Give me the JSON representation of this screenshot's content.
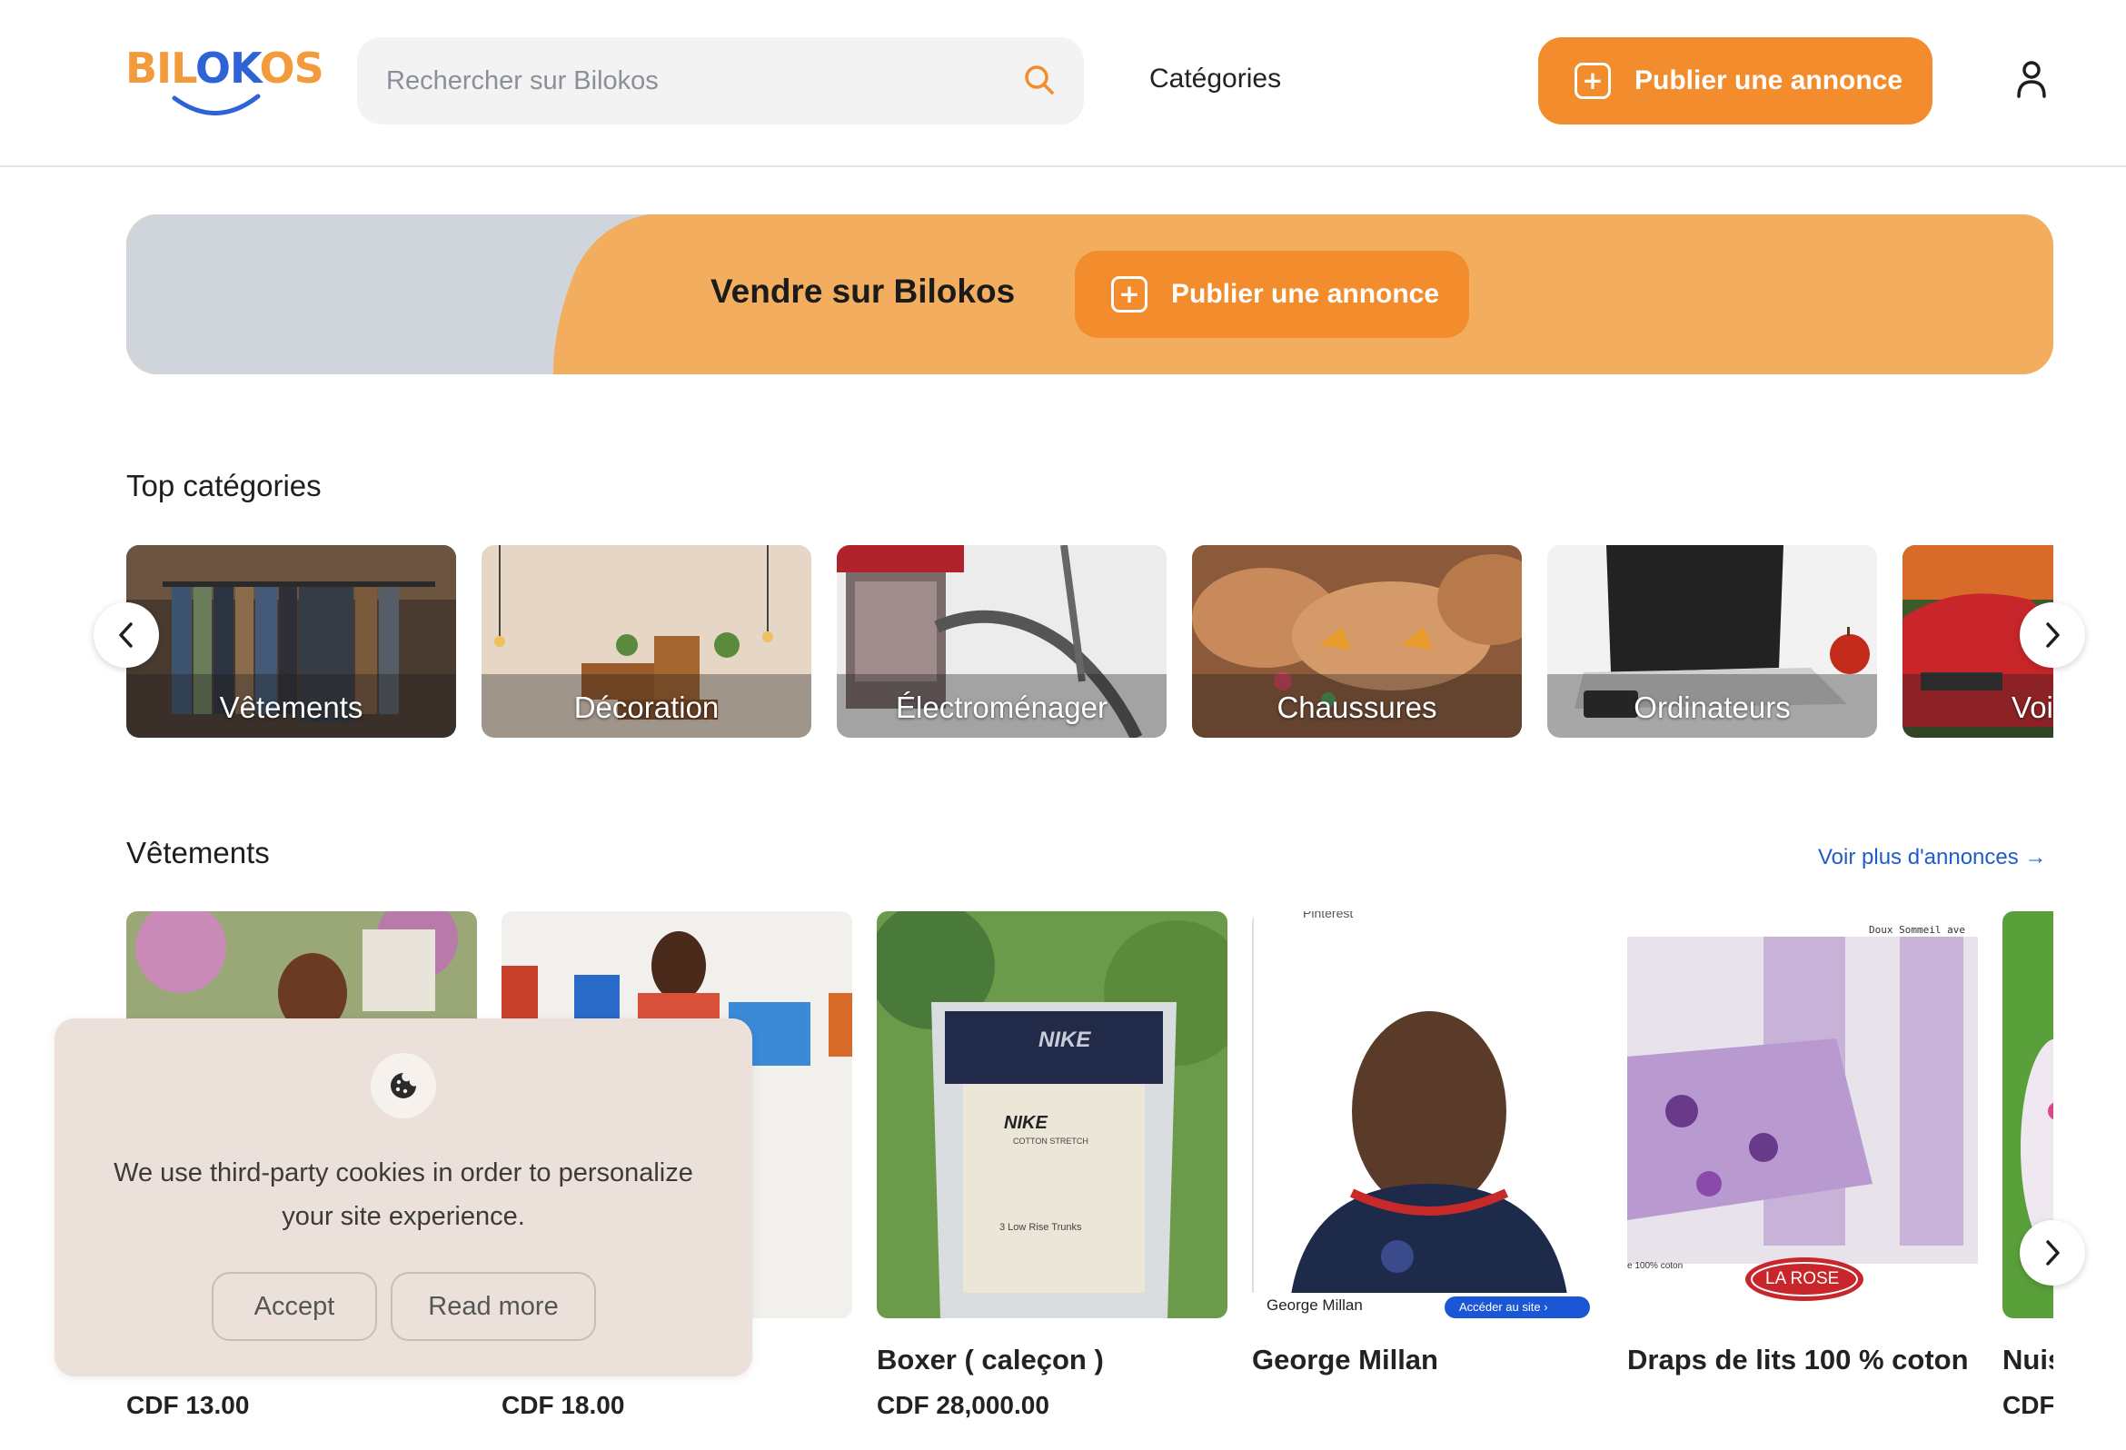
{
  "header": {
    "logo_text_1": "BIL",
    "logo_text_2": "OK",
    "logo_text_3": "OS",
    "search_placeholder": "Rechercher sur Bilokos",
    "nav_categories": "Catégories",
    "publish_label": "Publier une annonce",
    "icons": {
      "search": "search-icon",
      "user": "user-icon",
      "plus": "plus-square-icon"
    }
  },
  "banner": {
    "title": "Vendre sur Bilokos",
    "button_label": "Publier une annonce"
  },
  "top_categories": {
    "title": "Top catégories",
    "items": [
      {
        "label": "Vêtements"
      },
      {
        "label": "Décoration"
      },
      {
        "label": "Électroménager"
      },
      {
        "label": "Chaussures"
      },
      {
        "label": "Ordinateurs"
      },
      {
        "label": "Voi"
      }
    ]
  },
  "vetements": {
    "title": "Vêtements",
    "see_more": "Voir plus d'annonces →",
    "products": [
      {
        "name": "",
        "price": "CDF 13.00"
      },
      {
        "name": "",
        "price": "CDF 18.00"
      },
      {
        "name": "Boxer ( caleçon )",
        "price": "CDF 28,000.00"
      },
      {
        "name": "George Millan",
        "price": ""
      },
      {
        "name": "Draps de lits 100 % coton",
        "price": ""
      },
      {
        "name": "Nuis",
        "price": "CDF"
      }
    ],
    "image_texts": {
      "nike_brand": "NIKE",
      "nike_sub": "COTTON STRETCH",
      "nike_trunks": "3 Low Rise Trunks",
      "pinterest": "Pinterest",
      "george_caption": "George Millan",
      "george_button": "Accéder au site ›",
      "draps_header": "Doux Sommeil ave",
      "draps_coton": "e 100% coton",
      "draps_brand": "LA ROSE"
    }
  },
  "cookie": {
    "text": "We use third-party cookies in order to personalize your site experience.",
    "accept": "Accept",
    "read_more": "Read more"
  },
  "colors": {
    "brand_orange": "#f28c2c",
    "brand_blue": "#2e63d8",
    "link_blue": "#1f5cc9",
    "banner_orange": "#f3ad5f",
    "banner_grey": "#cfd5da",
    "cookie_bg": "#ebe1da"
  }
}
